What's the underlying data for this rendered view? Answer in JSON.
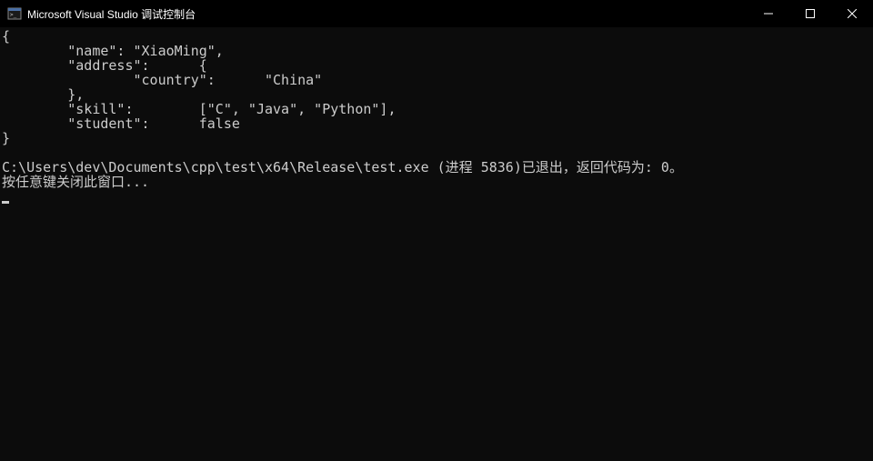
{
  "window": {
    "title": "Microsoft Visual Studio 调试控制台"
  },
  "console": {
    "line1": "{",
    "line2": "        \"name\": \"XiaoMing\",",
    "line3": "        \"address\":      {",
    "line4": "                \"country\":      \"China\"",
    "line5": "        },",
    "line6": "        \"skill\":        [\"C\", \"Java\", \"Python\"],",
    "line7": "        \"student\":      false",
    "line8": "}",
    "line9": "",
    "line10": "C:\\Users\\dev\\Documents\\cpp\\test\\x64\\Release\\test.exe (进程 5836)已退出，返回代码为: 0。",
    "line11": "按任意键关闭此窗口..."
  }
}
